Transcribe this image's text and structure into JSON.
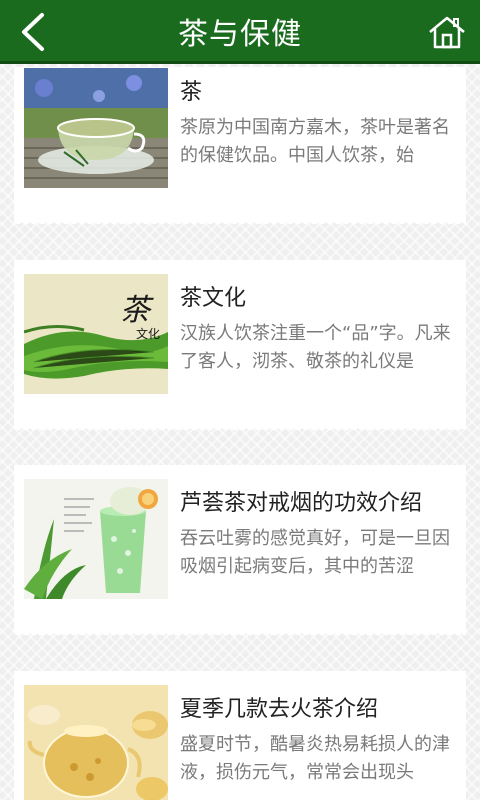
{
  "header": {
    "title": "茶与保健",
    "back_icon": "chevron-left-icon",
    "home_icon": "home-icon",
    "bar_color": "#1b6b1f"
  },
  "articles": [
    {
      "title": "茶",
      "summary": "茶原为中国南方嘉木，茶叶是著名的保健饮品。中国人饮茶，始",
      "image": "glass-teacup-photo"
    },
    {
      "title": "茶文化",
      "summary": "汉族人饮茶注重一个“品”字。凡来了客人，沏茶、敬茶的礼仪是",
      "image": "tea-plantation-calligraphy-photo",
      "image_caption_big": "茶",
      "image_caption_small": "文化"
    },
    {
      "title": "芦荟茶对戒烟的功效介绍",
      "summary": "吞云吐雾的感觉真好，可是一旦因吸烟引起病变后，其中的苦涩",
      "image": "aloe-vera-drink-photo"
    },
    {
      "title": "夏季几款去火茶介绍",
      "summary": "盛夏时节，酷暑炎热易耗损人的津液，损伤元气，常常会出现头",
      "image": "glass-teapot-photo"
    }
  ]
}
